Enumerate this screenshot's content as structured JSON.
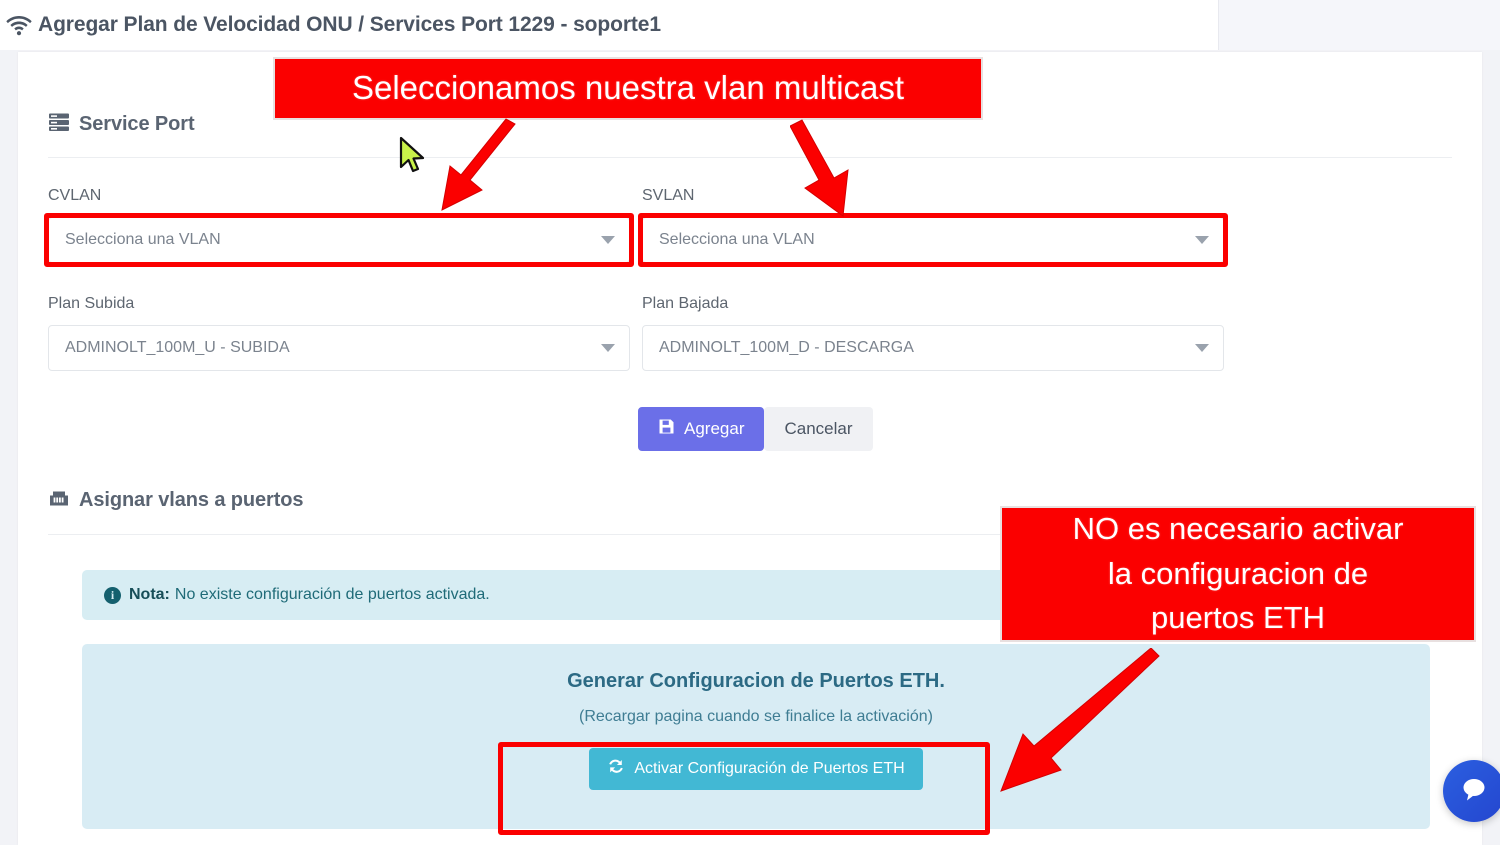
{
  "header": {
    "icon": "wifi-icon",
    "title": "Agregar Plan de Velocidad ONU / Services Port 1229 - soporte1"
  },
  "service_port": {
    "icon": "server-rack-icon",
    "heading": "Service Port",
    "fields": {
      "cvlan": {
        "label": "CVLAN",
        "value": "Selecciona una VLAN",
        "placeholder": "Selecciona una VLAN",
        "highlighted": true
      },
      "svlan": {
        "label": "SVLAN",
        "value": "Selecciona una VLAN",
        "placeholder": "Selecciona una VLAN",
        "highlighted": true
      },
      "plan_subida": {
        "label": "Plan Subida",
        "value": "ADMINOLT_100M_U - SUBIDA",
        "highlighted": false
      },
      "plan_bajada": {
        "label": "Plan Bajada",
        "value": "ADMINOLT_100M_D - DESCARGA",
        "highlighted": false
      }
    },
    "buttons": {
      "submit": {
        "label": "Agregar",
        "icon": "save-icon",
        "color": "#6b6fe8"
      },
      "cancel": {
        "label": "Cancelar",
        "color": "#f0f1f4"
      }
    }
  },
  "assign_vlans": {
    "icon": "ethernet-port-icon",
    "heading": "Asignar vlans a puertos",
    "note": {
      "icon": "info-icon",
      "label": "Nota:",
      "text": "No existe configuración de puertos activada.",
      "color": "#d7edf3"
    },
    "activation_panel": {
      "title": "Generar Configuracion de Puertos ETH.",
      "subtitle": "(Recargar pagina cuando se finalice la activación)",
      "button": {
        "label": "Activar Configuración de Puertos ETH",
        "icon": "refresh-icon",
        "color": "#42b8d4"
      },
      "button_highlighted": true
    }
  },
  "annotations": {
    "top": {
      "text": "Seleccionamos nuestra vlan multicast",
      "color": "#fb0000",
      "text_color": "#ffffff"
    },
    "right": {
      "lines": [
        "NO es necesario activar",
        "la configuracion de",
        "puertos ETH"
      ],
      "color": "#fb0000",
      "text_color": "#ffffff"
    },
    "arrows": [
      {
        "name": "arrow-to-cvlan",
        "color": "#fb0000"
      },
      {
        "name": "arrow-to-svlan",
        "color": "#fb0000"
      },
      {
        "name": "arrow-to-activar-button",
        "color": "#fb0000"
      }
    ],
    "cursor": {
      "name": "mouse-cursor",
      "fill": "#c9f24a"
    }
  },
  "chat_widget": {
    "icon": "chat-bubble-icon",
    "color": "#2b5fe0"
  }
}
